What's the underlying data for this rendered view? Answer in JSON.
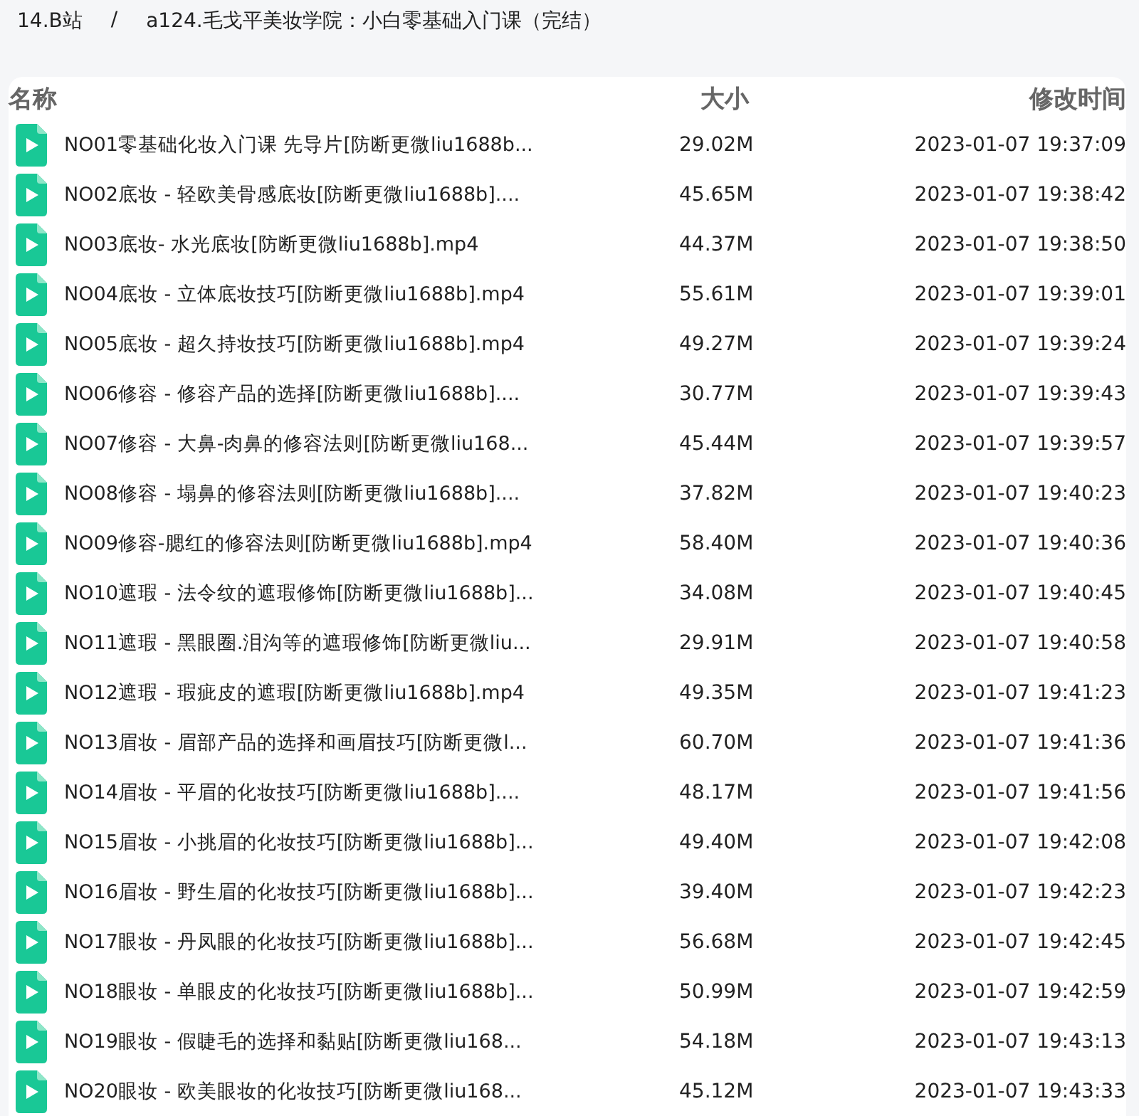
{
  "breadcrumb": [
    {
      "label": "14.B站"
    },
    {
      "label": "/"
    },
    {
      "label": "a124.毛戈平美妆学院：小白零基础入门课（完结）"
    }
  ],
  "table": {
    "columns": [
      "名称",
      "大小",
      "修改时间"
    ],
    "rows": [
      {
        "name": "NO01零基础化妆入门课 先导片[防断更微liu1688b...",
        "size": "29.02M",
        "modified": "2023-01-07 19:37:09"
      },
      {
        "name": "NO02底妆 - 轻欧美骨感底妆[防断更微liu1688b]....",
        "size": "45.65M",
        "modified": "2023-01-07 19:38:42"
      },
      {
        "name": "NO03底妆- 水光底妆[防断更微liu1688b].mp4",
        "size": "44.37M",
        "modified": "2023-01-07 19:38:50"
      },
      {
        "name": "NO04底妆 - 立体底妆技巧[防断更微liu1688b].mp4",
        "size": "55.61M",
        "modified": "2023-01-07 19:39:01"
      },
      {
        "name": "NO05底妆 - 超久持妆技巧[防断更微liu1688b].mp4",
        "size": "49.27M",
        "modified": "2023-01-07 19:39:24"
      },
      {
        "name": "NO06修容 - 修容产品的选择[防断更微liu1688b]....",
        "size": "30.77M",
        "modified": "2023-01-07 19:39:43"
      },
      {
        "name": "NO07修容 - 大鼻-肉鼻的修容法则[防断更微liu168...",
        "size": "45.44M",
        "modified": "2023-01-07 19:39:57"
      },
      {
        "name": "NO08修容 - 塌鼻的修容法则[防断更微liu1688b]....",
        "size": "37.82M",
        "modified": "2023-01-07 19:40:23"
      },
      {
        "name": "NO09修容-腮红的修容法则[防断更微liu1688b].mp4",
        "size": "58.40M",
        "modified": "2023-01-07 19:40:36"
      },
      {
        "name": "NO10遮瑕 - 法令纹的遮瑕修饰[防断更微liu1688b]...",
        "size": "34.08M",
        "modified": "2023-01-07 19:40:45"
      },
      {
        "name": "NO11遮瑕 - 黑眼圈.泪沟等的遮瑕修饰[防断更微liu...",
        "size": "29.91M",
        "modified": "2023-01-07 19:40:58"
      },
      {
        "name": "NO12遮瑕 - 瑕疵皮的遮瑕[防断更微liu1688b].mp4",
        "size": "49.35M",
        "modified": "2023-01-07 19:41:23"
      },
      {
        "name": "NO13眉妆 - 眉部产品的选择和画眉技巧[防断更微l...",
        "size": "60.70M",
        "modified": "2023-01-07 19:41:36"
      },
      {
        "name": "NO14眉妆 - 平眉的化妆技巧[防断更微liu1688b]....",
        "size": "48.17M",
        "modified": "2023-01-07 19:41:56"
      },
      {
        "name": "NO15眉妆 - 小挑眉的化妆技巧[防断更微liu1688b]...",
        "size": "49.40M",
        "modified": "2023-01-07 19:42:08"
      },
      {
        "name": "NO16眉妆 - 野生眉的化妆技巧[防断更微liu1688b]...",
        "size": "39.40M",
        "modified": "2023-01-07 19:42:23"
      },
      {
        "name": "NO17眼妆 - 丹凤眼的化妆技巧[防断更微liu1688b]...",
        "size": "56.68M",
        "modified": "2023-01-07 19:42:45"
      },
      {
        "name": "NO18眼妆 - 单眼皮的化妆技巧[防断更微liu1688b]...",
        "size": "50.99M",
        "modified": "2023-01-07 19:42:59"
      },
      {
        "name": "NO19眼妆 - 假睫毛的选择和黏贴[防断更微liu168...",
        "size": "54.18M",
        "modified": "2023-01-07 19:43:13"
      },
      {
        "name": "NO20眼妆 - 欧美眼妆的化妆技巧[防断更微liu168...",
        "size": "45.12M",
        "modified": "2023-01-07 19:43:33"
      }
    ]
  }
}
